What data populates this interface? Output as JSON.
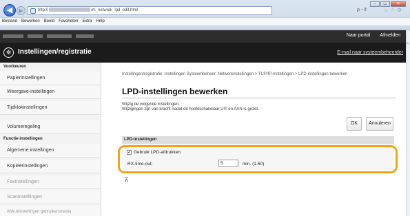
{
  "browser": {
    "url_prefix": "http://",
    "url_suffix": "/m_network_lpd_edit.html",
    "search_tools": "ρ - ¢",
    "window_controls": [
      "–",
      "▭",
      "✕"
    ],
    "menu": [
      "Bestand",
      "Bewerken",
      "Beeld",
      "Favorieten",
      "Extra",
      "Help"
    ]
  },
  "header": {
    "title": "Instellingen/registratie",
    "portal_link": "Naar portal",
    "logout_link": "Afmelden",
    "email_link": "E-mail naar systeembeheerder"
  },
  "sidebar": {
    "section1": "Voorkeuren",
    "items1": [
      "Papierinstellingen",
      "Weergave-instellingen",
      "Tijdklokinstellingen",
      "Volumeregeling"
    ],
    "section2": "Functie-instellingen",
    "items2": [
      "Algemene instellingen",
      "Kopieerinstellingen",
      "Faxinstellingen",
      "Scaninstellingen",
      "Afdrukinstellingen gebruikersmedia"
    ]
  },
  "main": {
    "breadcrumb": "Instellingen/registratie: Instellingen Systeembeheer: Netwerkinstellingen > TCP/IP-instellingen > LPD-instellingen bewerken",
    "title": "LPD-instellingen bewerken",
    "info_line1": "Wijzig de volgende instellingen.",
    "info_line2": "Wijzigingen zijn van kracht nadat de hoofdschakelaar UIT en AAN is gezet.",
    "ok_label": "OK",
    "cancel_label": "Annuleren",
    "section_title": "LPD-instellingen",
    "checkbox_label": "Gebruik LPD-afdrukken",
    "checkbox_checked": true,
    "checkbox_mark": "✓",
    "timeout_label": "RX-time-out:",
    "timeout_value": "5",
    "timeout_unit": "min. (1-60)",
    "top_icon": "⊼"
  },
  "colors": {
    "highlight": "#f3a21a",
    "header_bg": "#1b1b1b"
  }
}
